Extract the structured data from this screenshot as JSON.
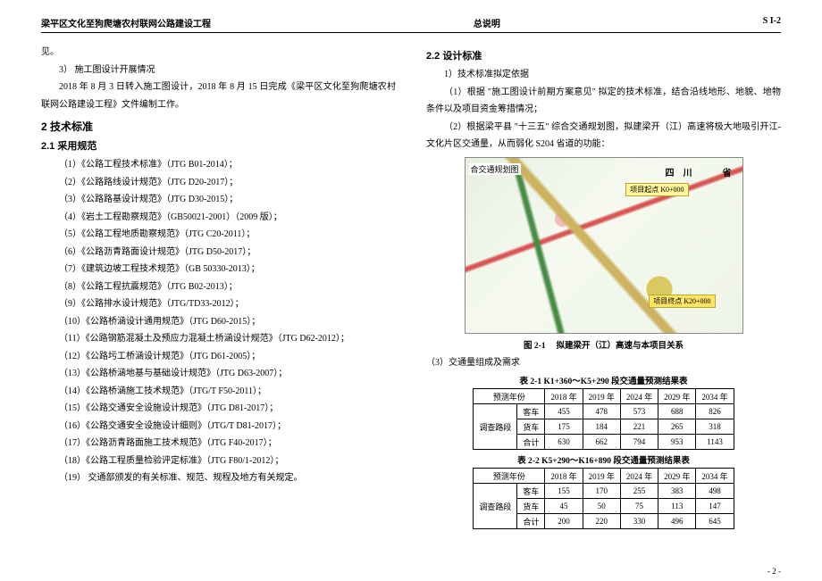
{
  "header": {
    "left": "梁平区文化至狗爬塘农村联网公路建设工程",
    "center": "总说明",
    "right": "S I-2"
  },
  "left": {
    "p1": "见。",
    "p2": "3） 施工图设计开展情况",
    "p3": "2018 年 8 月 3 日转入施工图设计，2018 年 8 月 15 日完成《梁平区文化至狗爬塘农村联网公路建设工程》文件编制工作。",
    "h2": "2 技术标准",
    "h3": "2.1 采用规范",
    "specs": [
      "（1）《公路工程技术标准》（JTG B01-2014）；",
      "（2）《公路路线设计规范》（JTG D20-2017）；",
      "（3）《公路路基设计规范》（JTG D30-2015）；",
      "（4）《岩土工程勘察规范》（GB50021-2001）（2009 版）；",
      "（5）《公路工程地质勘察规范》（JTG C20-2011）；",
      "（6）《公路沥青路面设计规范》（JTG D50-2017）；",
      "（7）《建筑边坡工程技术规范》（GB 50330-2013）；",
      "（8）《公路工程抗震规范》（JTG B02-2013）；",
      "（9）《公路排水设计规范》（JTG/TD33-2012）；",
      "（10）《公路桥涵设计通用规范》（JTG D60-2015）；",
      "（11）《公路钢筋混凝土及预应力混凝土桥涵设计规范》（JTG D62-2012）；",
      "（12）《公路圬工桥涵设计规范》（JTG D61-2005）；",
      "（13）《公路桥涵地基与基础设计规范》（JTG D63-2007）；",
      "（14）《公路桥涵施工技术规范》（JTG/T F50-2011）；",
      "（15）《公路交通安全设施设计规范》（JTG D81-2017）；",
      "（16）《公路交通安全设施设计细则》（JTG/T D81-2017）；",
      "（17）《公路沥青路面施工技术规范》（JTG F40-2017）；",
      "（18）《公路工程质量检验评定标准》（JTG F80/1-2012）；",
      "（19） 交通部颁发的有关标准、规范、规程及地方有关规定。"
    ]
  },
  "right": {
    "h3": "2.2 设计标准",
    "p1": "1）技术标准拟定依据",
    "p2": "（1）根据 \"施工图设计前期方案意见\" 拟定的技术标准，结合沿线地形、地貌、地物条件以及项目资金筹措情况；",
    "p3": "（2）根据梁平县 \"十三五\" 综合交通规划图，拟建梁开（江）高速将极大地吸引开江-文化片区交通量，从而弱化 S204 省道的功能：",
    "fig": {
      "label1": "合交通规划图",
      "label2": "四　川",
      "label3": "省",
      "box_a": "项目起点 K0+000",
      "box_b": "项目终点 K20+000",
      "caption": "图 2-1　 拟建梁开（江）高速与本项目关系"
    },
    "p4": "（3）交通量组成及需求",
    "tbl1": {
      "title": "表 2-1 K1+360～K5+290 段交通量预测结果表",
      "header_year": "预测年份",
      "section": "调查路段",
      "cols": [
        "2018 年",
        "2019 年",
        "2024 年",
        "2029 年",
        "2034 年"
      ],
      "rows": [
        {
          "label": "客车",
          "vals": [
            "455",
            "478",
            "573",
            "688",
            "826"
          ]
        },
        {
          "label": "货车",
          "vals": [
            "175",
            "184",
            "221",
            "265",
            "318"
          ]
        },
        {
          "label": "合计",
          "vals": [
            "630",
            "662",
            "794",
            "953",
            "1143"
          ]
        }
      ]
    },
    "tbl2": {
      "title": "表 2-2 K5+290～K16+890 段交通量预测结果表",
      "header_year": "预测年份",
      "section": "调查路段",
      "cols": [
        "2018 年",
        "2019 年",
        "2024 年",
        "2029 年",
        "2034 年"
      ],
      "rows": [
        {
          "label": "客车",
          "vals": [
            "155",
            "170",
            "255",
            "383",
            "498"
          ]
        },
        {
          "label": "货车",
          "vals": [
            "45",
            "50",
            "75",
            "113",
            "147"
          ]
        },
        {
          "label": "合计",
          "vals": [
            "200",
            "220",
            "330",
            "496",
            "645"
          ]
        }
      ]
    }
  },
  "pagenum": "- 2 -",
  "chart_data": [
    {
      "type": "table",
      "title": "表 2-1 K1+360～K5+290 段交通量预测结果表",
      "categories": [
        "2018 年",
        "2019 年",
        "2024 年",
        "2029 年",
        "2034 年"
      ],
      "series": [
        {
          "name": "客车",
          "values": [
            455,
            478,
            573,
            688,
            826
          ]
        },
        {
          "name": "货车",
          "values": [
            175,
            184,
            221,
            265,
            318
          ]
        },
        {
          "name": "合计",
          "values": [
            630,
            662,
            794,
            953,
            1143
          ]
        }
      ]
    },
    {
      "type": "table",
      "title": "表 2-2 K5+290～K16+890 段交通量预测结果表",
      "categories": [
        "2018 年",
        "2019 年",
        "2024 年",
        "2029 年",
        "2034 年"
      ],
      "series": [
        {
          "name": "客车",
          "values": [
            155,
            170,
            255,
            383,
            498
          ]
        },
        {
          "name": "货车",
          "values": [
            45,
            50,
            75,
            113,
            147
          ]
        },
        {
          "name": "合计",
          "values": [
            200,
            220,
            330,
            496,
            645
          ]
        }
      ]
    }
  ]
}
